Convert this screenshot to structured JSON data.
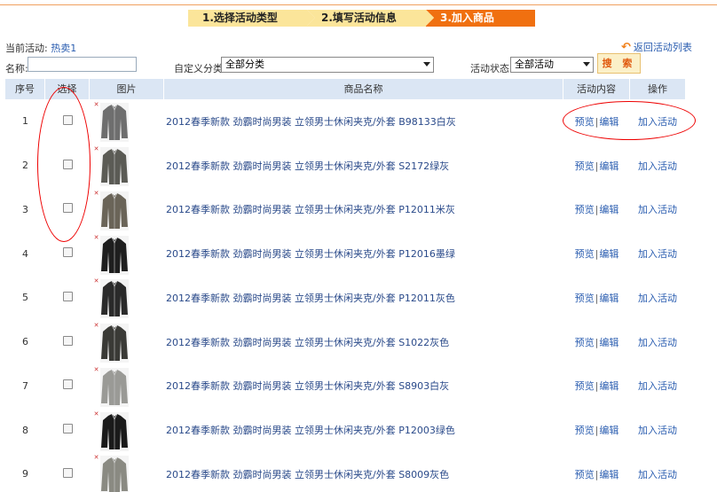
{
  "steps": [
    "1.选择活动类型",
    "2.填写活动信息",
    "3.加入商品"
  ],
  "current_activity_label": "当前活动:",
  "current_activity_value": "热卖1",
  "back_link": "返回活动列表",
  "filters": {
    "name_label": "名称:",
    "name_value": "",
    "category_label": "自定义分类:",
    "category_value": "全部分类",
    "status_label": "活动状态:",
    "status_value": "全部活动",
    "search_label": "搜 索"
  },
  "table": {
    "headers": [
      "序号",
      "选择",
      "图片",
      "商品名称",
      "活动内容",
      "操作"
    ],
    "preview_label": "预览",
    "edit_label": "编辑",
    "separator": "|",
    "add_label": "加入活动",
    "rows": [
      {
        "index": "1",
        "name": "2012春季新款 劲霸时尚男装 立领男士休闲夹克/外套 B98133白灰"
      },
      {
        "index": "2",
        "name": "2012春季新款 劲霸时尚男装 立领男士休闲夹克/外套 S2172绿灰"
      },
      {
        "index": "3",
        "name": "2012春季新款 劲霸时尚男装 立领男士休闲夹克/外套 P12011米灰"
      },
      {
        "index": "4",
        "name": "2012春季新款 劲霸时尚男装 立领男士休闲夹克/外套 P12016墨绿"
      },
      {
        "index": "5",
        "name": "2012春季新款 劲霸时尚男装 立领男士休闲夹克/外套 P12011灰色"
      },
      {
        "index": "6",
        "name": "2012春季新款 劲霸时尚男装 立领男士休闲夹克/外套 S1022灰色"
      },
      {
        "index": "7",
        "name": "2012春季新款 劲霸时尚男装 立领男士休闲夹克/外套 S8903白灰"
      },
      {
        "index": "8",
        "name": "2012春季新款 劲霸时尚男装 立领男士休闲夹克/外套 P12003绿色"
      },
      {
        "index": "9",
        "name": "2012春季新款 劲霸时尚男装 立领男士休闲夹克/外套 S8009灰色"
      }
    ]
  },
  "colors": {
    "accent": "#f07010",
    "step_bg": "#fbe59a",
    "header_bg": "#dbe6f4",
    "link": "#2a5db0",
    "annotation": "#e00000"
  }
}
